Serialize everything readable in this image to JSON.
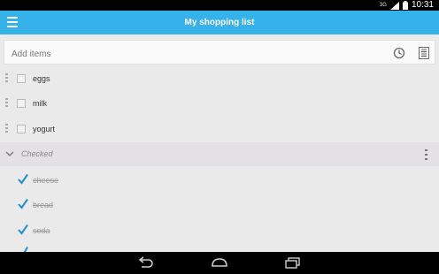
{
  "status": {
    "network": "3G",
    "time": "10:31"
  },
  "appbar": {
    "title": "My shopping list"
  },
  "add": {
    "placeholder": "Add items"
  },
  "items": [
    {
      "label": "eggs"
    },
    {
      "label": "milk"
    },
    {
      "label": "yogurt"
    }
  ],
  "checked_section": {
    "label": "Checked"
  },
  "checked_items": [
    {
      "label": "cheese"
    },
    {
      "label": "bread"
    },
    {
      "label": "soda"
    }
  ],
  "colors": {
    "accent": "#35b2ea",
    "check": "#1a8fd6"
  }
}
